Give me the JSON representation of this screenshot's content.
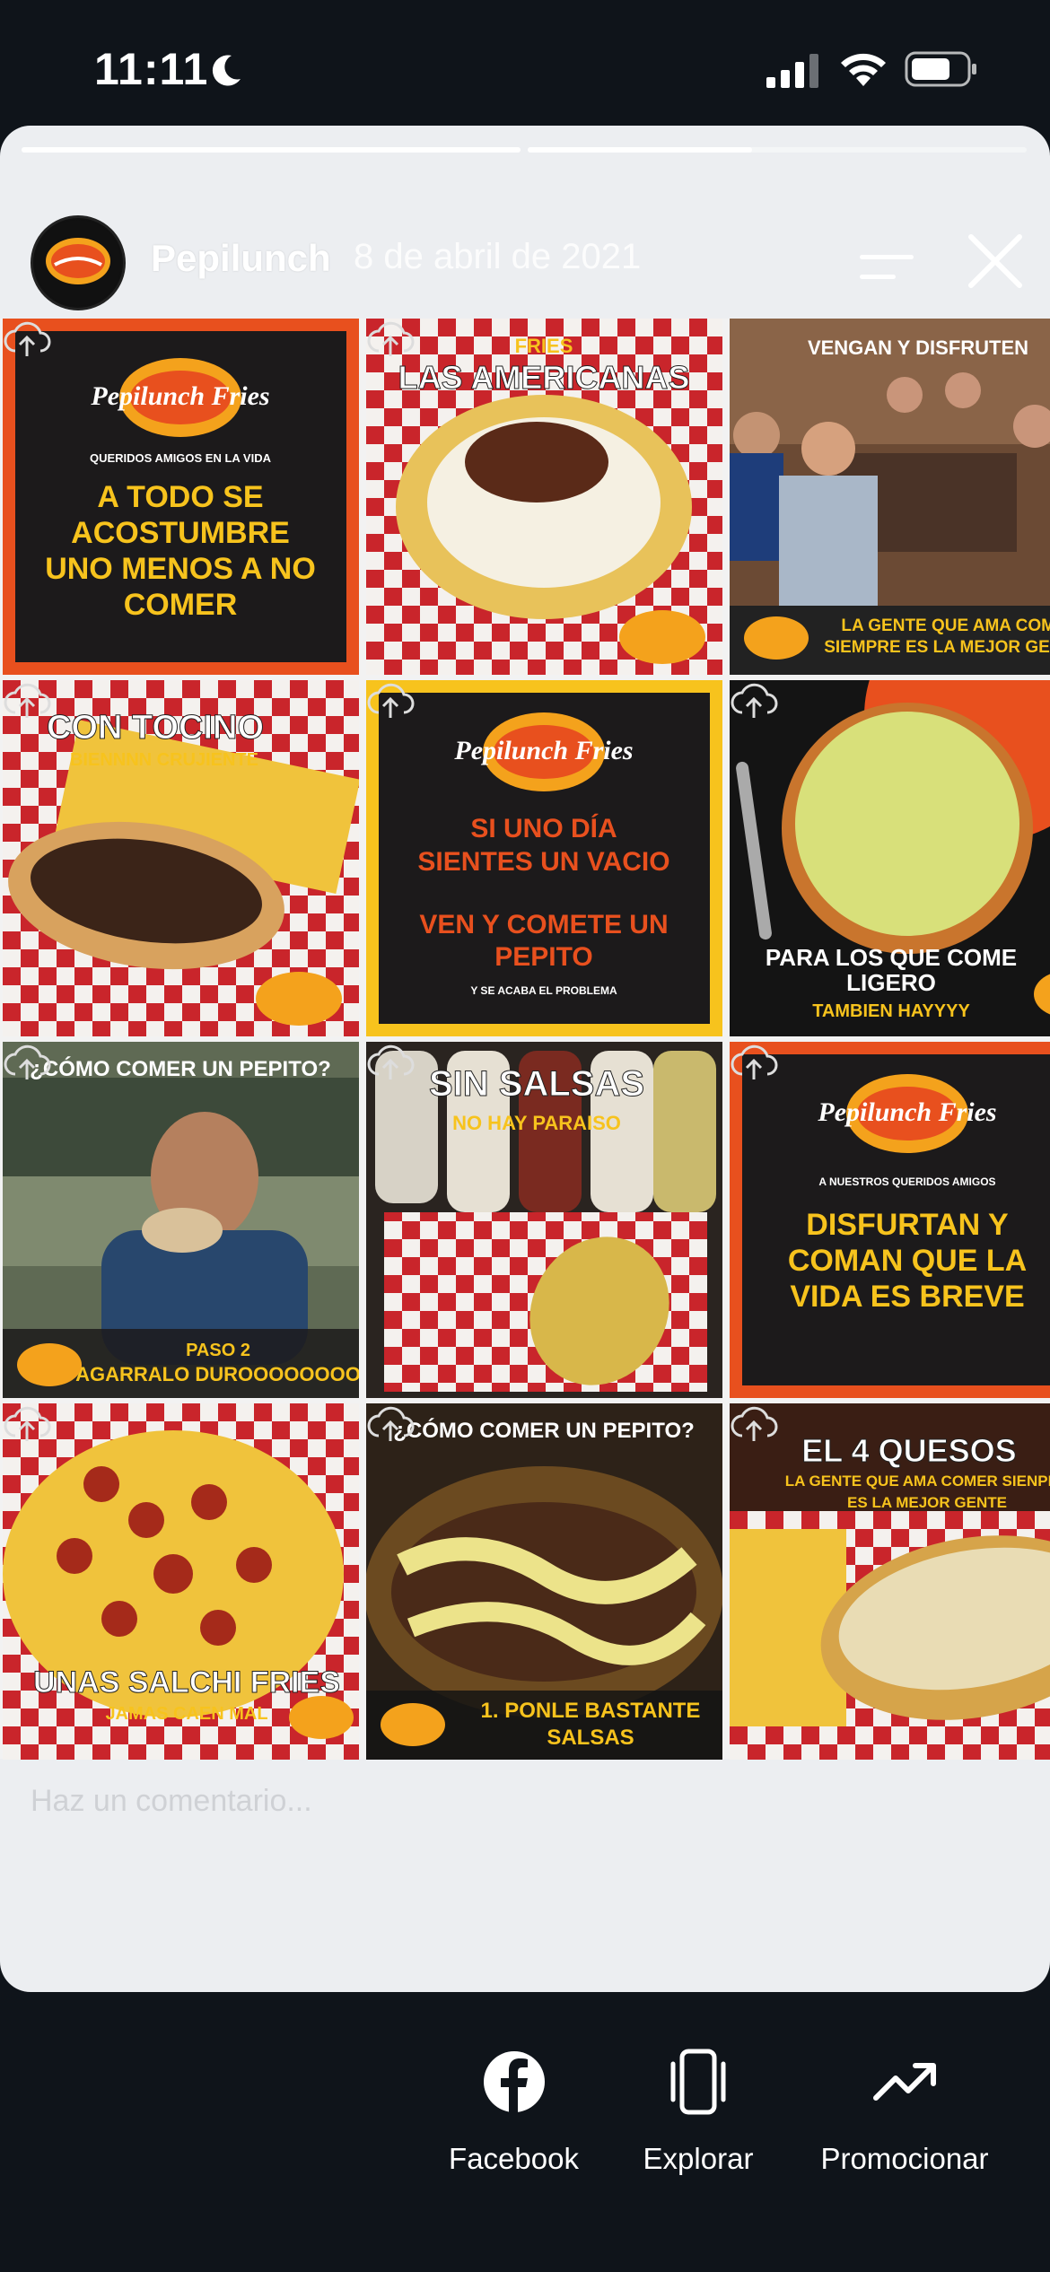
{
  "status_bar": {
    "time": "11:11",
    "icons": [
      "moon-icon",
      "cellular-signal-icon",
      "wifi-icon",
      "battery-icon"
    ]
  },
  "story": {
    "author": "Pepilunch",
    "date": "8 de abril de 2021",
    "progress_segments": [
      1,
      0.45
    ],
    "comment_placeholder": "Haz un comentario..."
  },
  "tiles": [
    {
      "brand": "Pepilunch Fries",
      "small": "QUERIDOS AMIGOS EN LA VIDA",
      "lines": [
        "A TODO SE",
        "ACOSTUMBRE",
        "UNO MENOS A NO",
        "COMER"
      ]
    },
    {
      "title_small": "FRIES",
      "title": "LAS AMERICANAS"
    },
    {
      "title": "VENGAN Y DISFRUTEN",
      "caption": [
        "LA GENTE QUE AMA COME",
        "SIEMPRE ES LA MEJOR GENTE"
      ]
    },
    {
      "title": "CON TOCINO",
      "subtitle": "BIENNNN CRUJIENTE"
    },
    {
      "brand": "Pepilunch Fries",
      "lines": [
        "SI UNO DÍA",
        "SIENTES UN VACIO",
        "",
        "VEN Y COMETE UN",
        "PEPITO"
      ],
      "small": "Y SE ACABA EL PROBLEMA"
    },
    {
      "caption": [
        "PARA LOS QUE COME",
        "LIGERO"
      ],
      "subcaption": "TAMBIEN HAYYYY"
    },
    {
      "title": "¿CÓMO COMER UN PEPITO?",
      "caption": [
        "PASO 2",
        "AGARRALO DUROOOOOOOO"
      ]
    },
    {
      "title": "SIN SALSAS",
      "subtitle": "NO HAY PARAISO"
    },
    {
      "brand": "Pepilunch Fries",
      "small": "A NUESTROS QUERIDOS AMIGOS",
      "lines": [
        "DISFURTAN Y",
        "COMAN QUE LA",
        "VIDA ES BREVE"
      ]
    },
    {
      "caption": [
        "UNAS SALCHI FRIES"
      ],
      "subcaption": "JAMAS CAEN MAL"
    },
    {
      "title": "¿CÓMO COMER UN PEPITO?",
      "caption": [
        "1.  PONLE BASTANTE",
        "SALSAS"
      ]
    },
    {
      "title": "EL 4 QUESOS",
      "subtitle": "LA GENTE QUE AMA COMER SIENPRE",
      "subtitle2": "ES LA MEJOR GENTE"
    }
  ],
  "actions": [
    {
      "label": "Facebook",
      "icon": "facebook-icon"
    },
    {
      "label": "Explorar",
      "icon": "explore-icon"
    },
    {
      "label": "Promocionar",
      "icon": "trending-up-icon"
    }
  ],
  "colors": {
    "accent_orange": "#e8501e",
    "accent_yellow": "#f7c31d",
    "dark_panel": "#1c1a1b",
    "background": "#0f141a"
  }
}
